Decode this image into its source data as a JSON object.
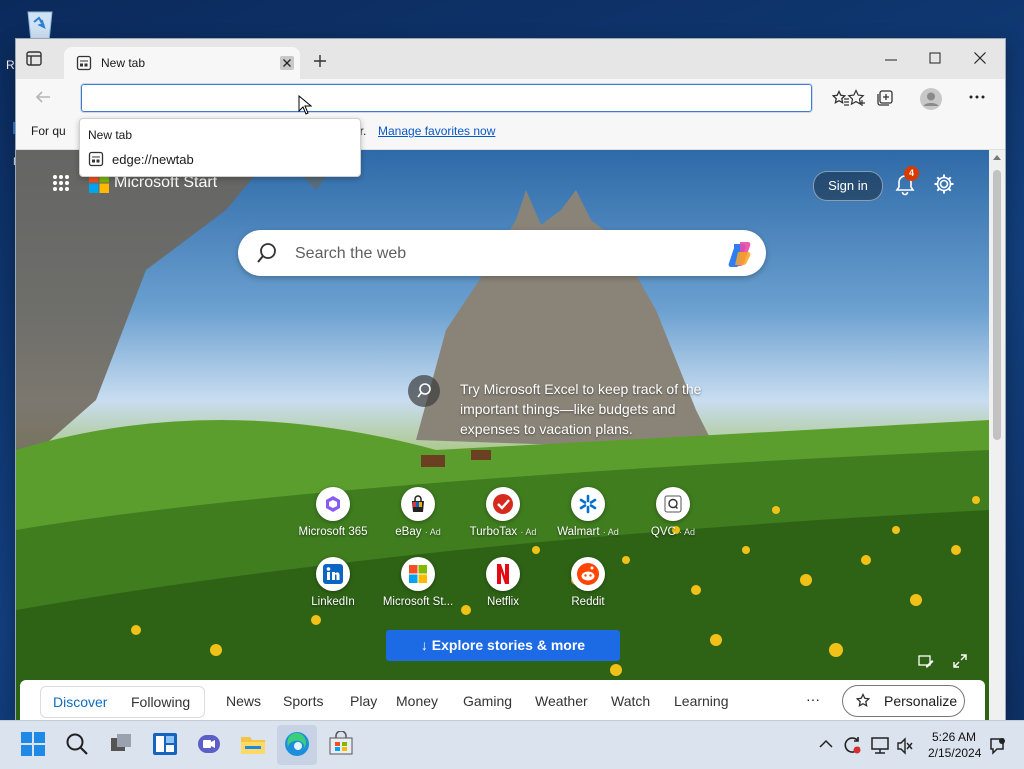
{
  "desktop": {
    "left_edge_text_1": "R",
    "left_edge_text_2": "N"
  },
  "browser": {
    "tab": {
      "title": "New tab"
    },
    "flyout": {
      "title": "New tab",
      "url": "edge://newtab"
    },
    "favorites_bar": {
      "lead": "For qu",
      "tail": "s bar.",
      "link": "Manage favorites now"
    }
  },
  "page": {
    "brand": "Microsoft Start",
    "signin": "Sign in",
    "notification_count": "4",
    "search_placeholder": "Search the web",
    "promo_text": "Try Microsoft Excel to keep track of the important things—like budgets and expenses to vacation plans.",
    "tiles_row1": [
      {
        "label": "Microsoft 365",
        "ad": ""
      },
      {
        "label": "eBay",
        "ad": "· Ad"
      },
      {
        "label": "TurboTax",
        "ad": "· Ad"
      },
      {
        "label": "Walmart",
        "ad": "· Ad"
      },
      {
        "label": "QVC",
        "ad": "· Ad"
      }
    ],
    "tiles_row2": [
      {
        "label": "LinkedIn",
        "ad": ""
      },
      {
        "label": "Microsoft St...",
        "ad": ""
      },
      {
        "label": "Netflix",
        "ad": ""
      },
      {
        "label": "Reddit",
        "ad": ""
      }
    ],
    "explore": "Explore stories & more",
    "feed": {
      "segment": [
        "Discover",
        "Following"
      ],
      "tabs": [
        "News",
        "Sports",
        "Play",
        "Money",
        "Gaming",
        "Weather",
        "Watch",
        "Learning"
      ],
      "more": "···",
      "personalize": "Personalize"
    }
  },
  "taskbar": {
    "time": "5:26 AM",
    "date": "2/15/2024"
  },
  "colors": {
    "accent": "#1c6ae4",
    "link": "#0a58ca",
    "badge": "#d83b01"
  }
}
